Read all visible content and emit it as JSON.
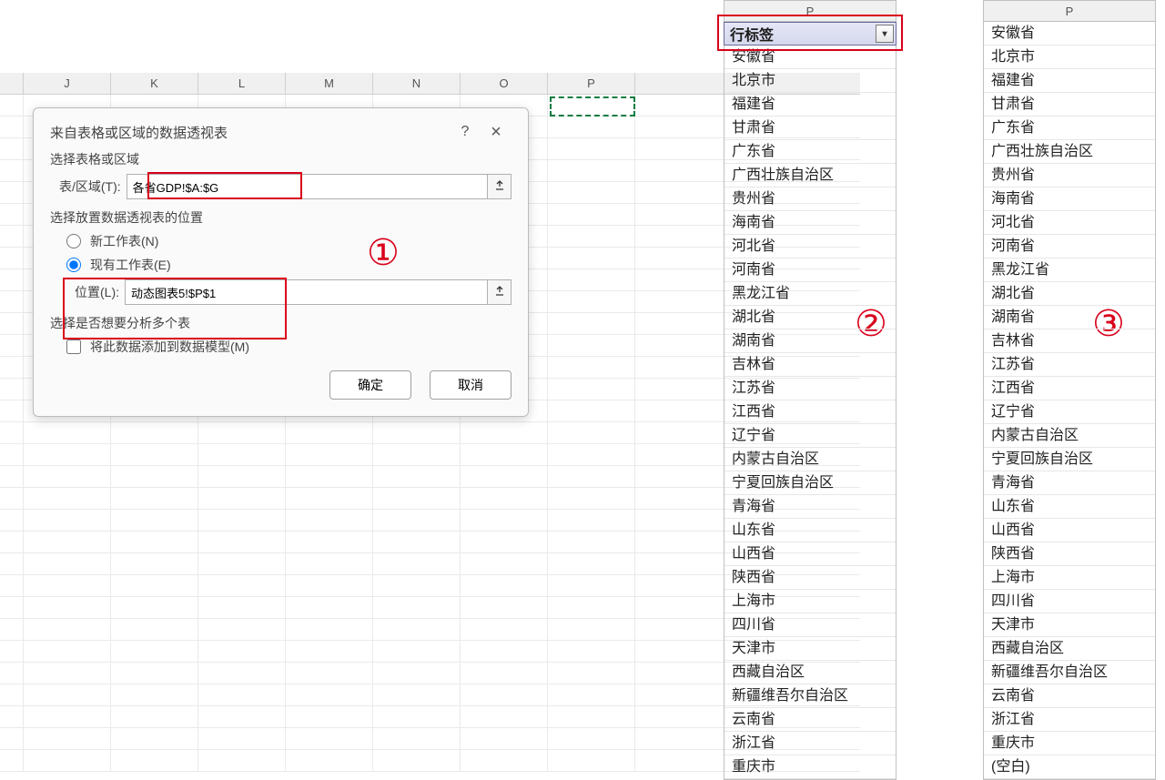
{
  "sheet": {
    "columns": [
      "J",
      "K",
      "L",
      "M",
      "N",
      "O",
      "P"
    ],
    "row_count": 31
  },
  "dialog": {
    "title": "来自表格或区域的数据透视表",
    "help_label": "?",
    "close_label": "×",
    "section1": "选择表格或区域",
    "table_range_label": "表/区域(T):",
    "table_range_value": "各省GDP!$A:$G",
    "section2": "选择放置数据透视表的位置",
    "radio_new_sheet": "新工作表(N)",
    "radio_existing_sheet": "现有工作表(E)",
    "location_label": "位置(L):",
    "location_value": "动态图表5!$P$1",
    "section3": "选择是否想要分析多个表",
    "checkbox_model": "将此数据添加到数据模型(M)",
    "ok": "确定",
    "cancel": "取消"
  },
  "circles": {
    "c1": "①",
    "c2": "②",
    "c3": "③"
  },
  "pivot2": {
    "column_letter": "P",
    "dropdown_label": "行标签",
    "items": [
      "安徽省",
      "北京市",
      "福建省",
      "甘肃省",
      "广东省",
      "广西壮族自治区",
      "贵州省",
      "海南省",
      "河北省",
      "河南省",
      "黑龙江省",
      "湖北省",
      "湖南省",
      "吉林省",
      "江苏省",
      "江西省",
      "辽宁省",
      "内蒙古自治区",
      "宁夏回族自治区",
      "青海省",
      "山东省",
      "山西省",
      "陕西省",
      "上海市",
      "四川省",
      "天津市",
      "西藏自治区",
      "新疆维吾尔自治区",
      "云南省",
      "浙江省",
      "重庆市"
    ]
  },
  "pivot3": {
    "column_letter": "P",
    "items": [
      "安徽省",
      "北京市",
      "福建省",
      "甘肃省",
      "广东省",
      "广西壮族自治区",
      "贵州省",
      "海南省",
      "河北省",
      "河南省",
      "黑龙江省",
      "湖北省",
      "湖南省",
      "吉林省",
      "江苏省",
      "江西省",
      "辽宁省",
      "内蒙古自治区",
      "宁夏回族自治区",
      "青海省",
      "山东省",
      "山西省",
      "陕西省",
      "上海市",
      "四川省",
      "天津市",
      "西藏自治区",
      "新疆维吾尔自治区",
      "云南省",
      "浙江省",
      "重庆市",
      "(空白)"
    ]
  }
}
